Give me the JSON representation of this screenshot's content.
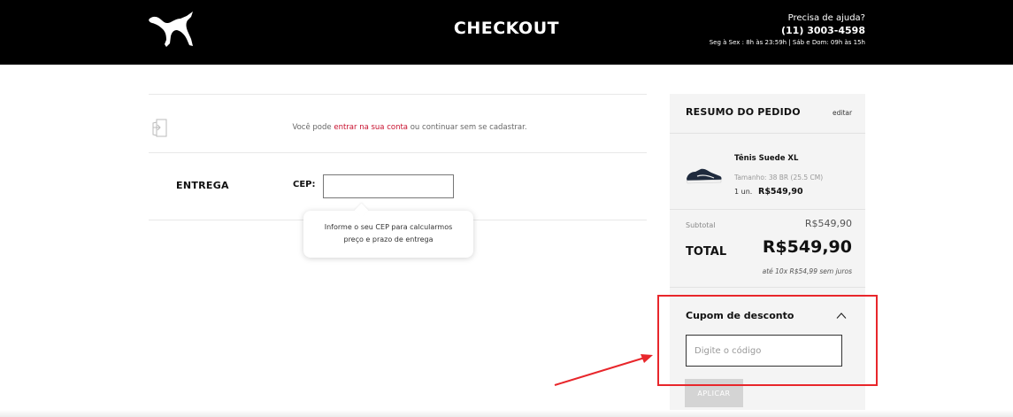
{
  "header": {
    "title": "CHECKOUT",
    "help_question": "Precisa de ajuda?",
    "help_phone": "(11) 3003-4598",
    "help_hours": "Seg à Sex : 8h às 23:59h | Sáb e Dom: 09h às 15h",
    "logo_icon": "puma-logo-icon"
  },
  "login": {
    "icon": "login-door-icon",
    "text_before": "Você pode ",
    "link": "entrar na sua conta",
    "text_after": " ou continuar sem se cadastrar."
  },
  "shipping": {
    "label": "ENTREGA",
    "cep_label": "CEP:",
    "cep_value": "",
    "tooltip_line1": "Informe o seu CEP para calcularmos",
    "tooltip_line2": "preço e prazo de entrega"
  },
  "summary": {
    "title": "RESUMO DO PEDIDO",
    "edit_label": "editar",
    "product": {
      "name": "Tênis Suede XL",
      "size": "Tamanho: 38 BR (25.5 CM)",
      "qty": "1 un.",
      "price": "R$549,90",
      "image": "sneaker-thumbnail"
    },
    "subtotal_label": "Subtotal",
    "subtotal_value": "R$549,90",
    "total_label": "TOTAL",
    "total_value": "R$549,90",
    "installments": "até 10x R$54,99 sem juros"
  },
  "coupon": {
    "title": "Cupom de desconto",
    "toggle_icon": "chevron-up-icon",
    "placeholder": "Digite o código",
    "value": "",
    "apply_label": "APLICAR"
  },
  "annotation": {
    "box_color": "#e8262b",
    "arrow_color": "#e8262b"
  },
  "colors": {
    "header_bg": "#000000",
    "link": "#c8102e",
    "summary_bg": "#f4f4f4"
  }
}
